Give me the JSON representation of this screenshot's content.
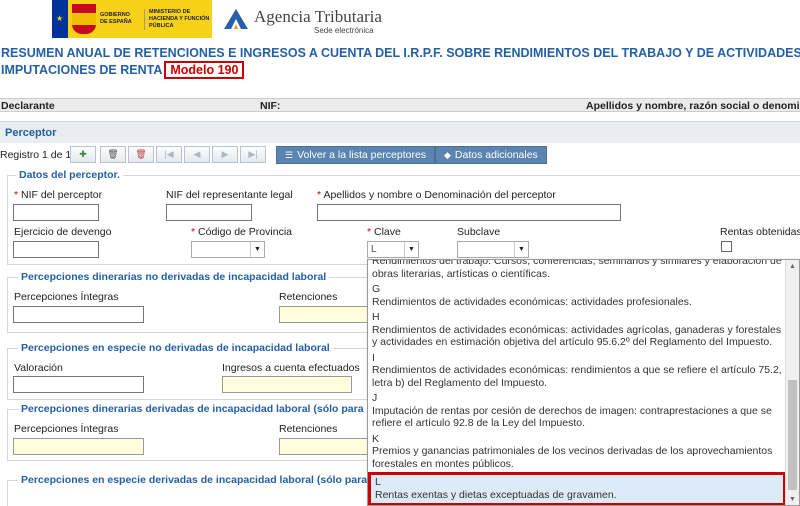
{
  "header": {
    "gov_text": "GOBIERNO DE ESPAÑA",
    "ministry_text": "MINISTERIO DE HACIENDA Y FUNCIÓN PÚBLICA",
    "agency_name": "Agencia Tributaria",
    "agency_sub": "Sede electrónica"
  },
  "title": {
    "line1": "RESUMEN ANUAL DE RETENCIONES E INGRESOS A CUENTA DEL I.R.P.F. SOBRE RENDIMIENTOS DEL TRABAJO Y DE ACTIVIDADES",
    "line2": "IMPUTACIONES DE RENTA",
    "model": "Modelo 190"
  },
  "declarante_bar": {
    "declarante": "Declarante",
    "nif": "NIF:",
    "apellidos": "Apellidos y nombre, razón social o denomina"
  },
  "perceptor": {
    "section_title": "Perceptor",
    "registro": "Registro 1 de 1",
    "btn_volver": "Volver a la lista perceptores",
    "btn_datos": "Datos adicionales"
  },
  "datos_perceptor": {
    "legend": "Datos del perceptor.",
    "nif_label": "NIF del perceptor",
    "nif_repr_label": "NIF del representante legal",
    "apellidos_label": "Apellidos y nombre o Denominación del perceptor",
    "ejercicio_label": "Ejercicio de devengo",
    "provincia_label": "Código de Provincia",
    "clave_label": "Clave",
    "clave_value": "L",
    "subclave_label": "Subclave",
    "rentas_label": "Rentas obtenidas",
    "required_mark": "*"
  },
  "sections": {
    "dinerarias_no": "Percepciones dinerarias no derivadas de incapacidad laboral",
    "dinerarias_no_integras": "Percepciones Íntegras",
    "dinerarias_no_retenciones": "Retenciones",
    "especie_no": "Percepciones en especie no derivadas de incapacidad laboral",
    "especie_no_valoracion": "Valoración",
    "especie_no_ingresos": "Ingresos a cuenta efectuados",
    "dinerarias_si": "Percepciones dinerarias derivadas de incapacidad laboral (sólo para clav",
    "dinerarias_si_integras": "Percepciones Íntegras",
    "dinerarias_si_retenciones": "Retenciones",
    "especie_si": "Percepciones en especie derivadas de incapacidad laboral (sólo para cla"
  },
  "dropdown": {
    "items": [
      {
        "code": "",
        "text": "Rendimientos del trabajo: Cursos, conferencias, seminarios y similares y elaboración de obras literarias, artísticas o científicas."
      },
      {
        "code": "G",
        "text": "Rendimientos de actividades económicas: actividades profesionales."
      },
      {
        "code": "H",
        "text": "Rendimientos de actividades económicas: actividades agrícolas, ganaderas y forestales y actividades en estimación objetiva del artículo 95.6.2º del Reglamento del Impuesto."
      },
      {
        "code": "I",
        "text": "Rendimientos de actividades económicas: rendimientos a que se refiere el artículo 75.2, letra b) del Reglamento del Impuesto."
      },
      {
        "code": "J",
        "text": "Imputación de rentas por cesión de derechos de imagen: contraprestaciones a que se refiere el artículo 92.8 de la Ley del Impuesto."
      },
      {
        "code": "K",
        "text": "Premios y ganancias patrimoniales de los vecinos derivadas de los aprovechamientos forestales en montes públicos."
      },
      {
        "code": "L",
        "text": "Rentas exentas y dietas exceptuadas de gravamen."
      }
    ],
    "selected_code": "L"
  },
  "colors": {
    "title_blue": "#2360a5",
    "highlight_red": "#cc0000",
    "button_blue": "#5b84b1",
    "input_yellow": "#ffffdd"
  }
}
